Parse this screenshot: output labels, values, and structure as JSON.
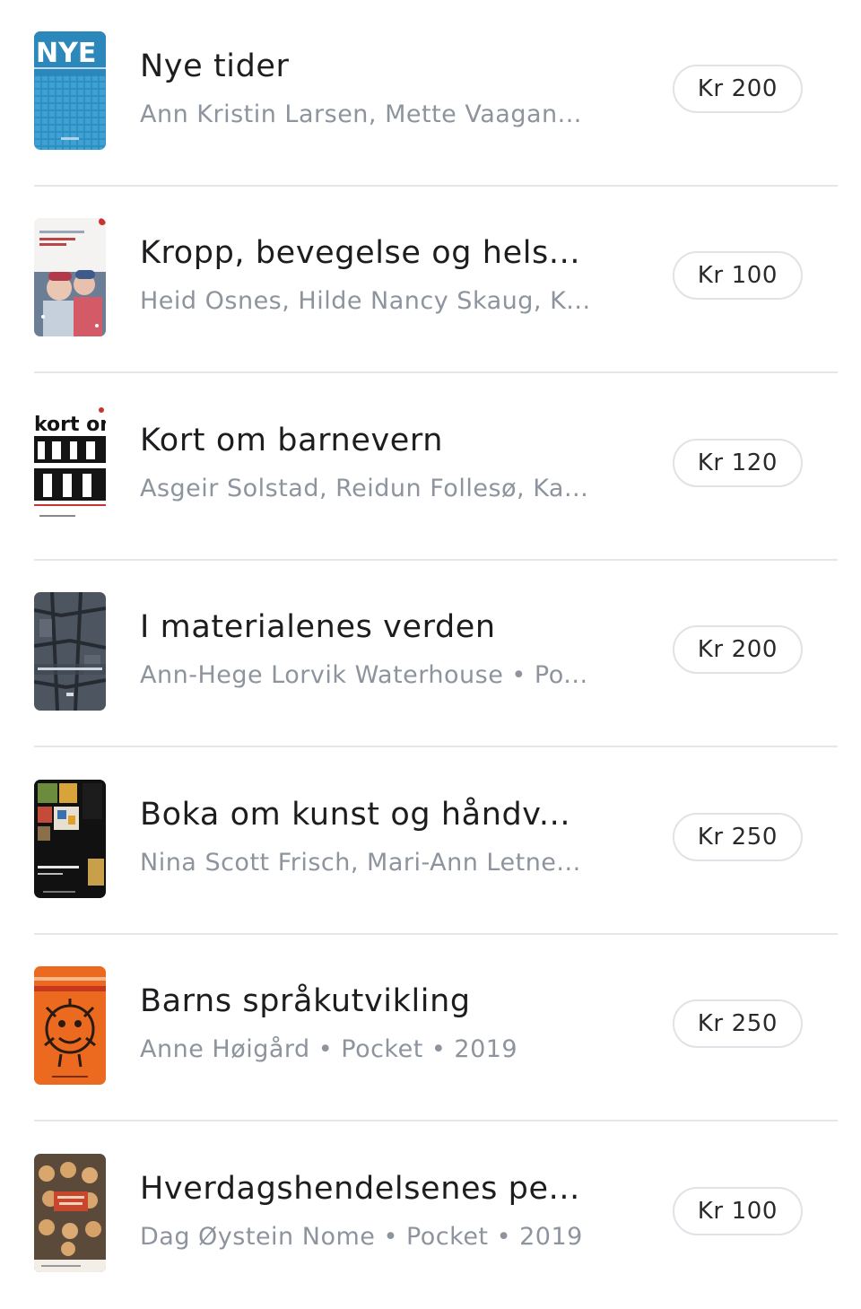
{
  "listings": [
    {
      "title": "Nye tider",
      "subtitle": "Ann Kristin Larsen, Mette Vaagan...",
      "price": "Kr 200",
      "cover_text": "NYE"
    },
    {
      "title": "Kropp, bevegelse og hels...",
      "subtitle": "Heid Osnes, Hilde Nancy Skaug, K...",
      "price": "Kr 100"
    },
    {
      "title": "Kort om barnevern",
      "subtitle": "Asgeir Solstad, Reidun Follesø, Ka...",
      "price": "Kr 120",
      "cover_text": "kort om"
    },
    {
      "title": "I materialenes verden",
      "subtitle": "Ann-Hege Lorvik Waterhouse • Po...",
      "price": "Kr 200"
    },
    {
      "title": "Boka om kunst og håndv...",
      "subtitle": "Nina Scott Frisch, Mari-Ann Letne...",
      "price": "Kr 250"
    },
    {
      "title": "Barns språkutvikling",
      "subtitle": "Anne Høigård • Pocket • 2019",
      "price": "Kr 250"
    },
    {
      "title": "Hverdagshendelsenes pe...",
      "subtitle": "Dag Øystein Nome • Pocket • 2019",
      "price": "Kr 100"
    }
  ]
}
